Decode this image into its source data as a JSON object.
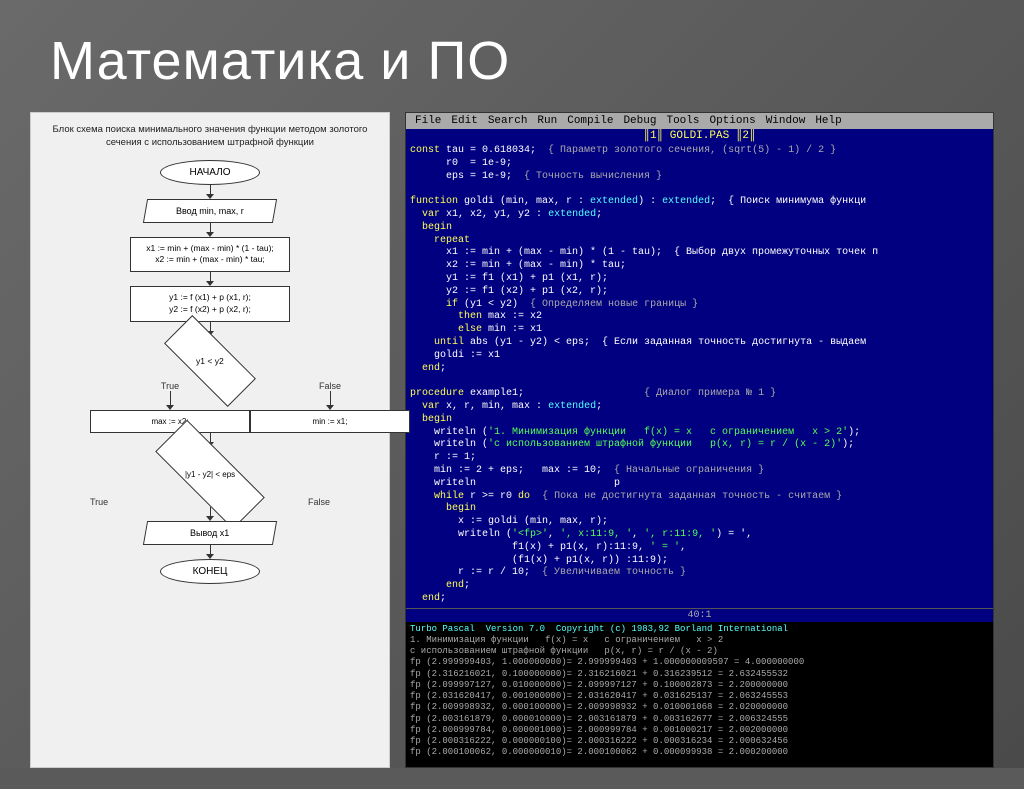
{
  "title": "Математика  и ПО",
  "flowchart": {
    "title": "Блок схема поиска минимального значения\nфункции методом золотого сечения\nс использованием штрафной функции",
    "nodes": {
      "start": "НАЧАЛО",
      "input": "Ввод min, max, r",
      "block1_line1": "x1 := min + (max - min) * (1 - tau);",
      "block1_line2": "x2 := min + (max - min) * tau;",
      "block2_line1": "y1 := f (x1) + p (x1, r);",
      "block2_line2": "y2 := f (x2) + p (x2, r);",
      "diamond1": "y1 < y2",
      "true_label1": "True",
      "false_label1": "False",
      "max_assign": "max := x2;",
      "min_assign": "min := x1;",
      "diamond2": "|y1 - y2| < eps",
      "true_label2": "True",
      "false_label2": "False",
      "output": "Вывод x1",
      "end": "КОНЕЦ"
    }
  },
  "code_editor": {
    "menubar": [
      "File",
      "Edit",
      "Search",
      "Run",
      "Compile",
      "Debug",
      "Tools",
      "Options",
      "Window",
      "Help"
    ],
    "titlebar": "GOLDI.PAS",
    "titlebar_right": "2",
    "lines": [
      "const tau = 0.618034;  { Параметр золотого сечения, (sqrt(5) - 1) / 2 }",
      "      r0  = 1e-9;",
      "      eps = 1e-9;  { Точность вычисления }",
      "",
      "function goldi (min, max, r : extended) : extended;  { Поиск минимума функци",
      "  var x1, x2, y1, y2 : extended;",
      "  begin",
      "    repeat",
      "      x1 := min + (max - min) * (1 - tau);  { Выбор двух промежуточных точек п",
      "      x2 := min + (max - min) * tau;",
      "      y1 := f1 (x1) + p1 (x1, r);",
      "      y2 := f1 (x2) + p1 (x2, r);",
      "      if (y1 < y2)  { Определяем новые границы }",
      "        then max := x2",
      "        else min := x1",
      "    until abs (y1 - y2) < eps;  { Если заданная точность достигнута - выдаем",
      "    goldi := x1",
      "  end;",
      "",
      "procedure example1;                    { Диалог примера № 1 }",
      "  var x, r, min, max : extended;",
      "  begin",
      "    writeln ('1. Минимизация функции   f(x) = x   с ограничением   x > 2');",
      "    writeln ('с использованием штрафной функции   p(x, r) = r / (x - 2)');",
      "    r := 1;",
      "    min := 2 + eps;   max := 10;  { Начальные ограничения }",
      "    writeln                       p",
      "    while r >= r0 do  { Пока не достигнута заданная точность - считаем }",
      "      begin",
      "        x := goldi (min, max, r);",
      "        writeln ('<fp>', ', x:11:9, ', ', r:11:9, ') = ',",
      "                 f1(x) + p1(x, r):11:9, ' = ',",
      "                 (f1(x) + p1(x, r)) :11:9);",
      "        r := r / 10;  { Увеличиваем точность }",
      "      end;",
      "  end;"
    ],
    "statusbar": "40:1",
    "output_header": "Turbo Pascal  Version 7.0  Copyright (c) 1983,92 Borland International",
    "output_lines": [
      "1. Минимизация функции   f(x) = x   с ограничением   x > 2",
      "с использованием штрафной функции   p(x, r) = r / (x - 2)",
      "fp (2.999999403, 1.000000000)= 2.999999403 + 1.000000009597 = 4.000000000",
      "fp (2.316216021, 0.100000000)= 2.316216021 + 0.316239512 = 2.632455532",
      "fp (2.099997127, 0.010000000)= 2.099997127 + 0.100002873 = 2.200000000",
      "fp (2.031620417, 0.001000000)= 2.031620417 + 0.031625137 = 2.063245553",
      "fp (2.009998932, 0.000100000)= 2.009998932 + 0.010001068 = 2.020000000",
      "fp (2.003161879, 0.000010000)= 2.003161879 + 0.003162677 = 2.006324555",
      "fp (2.000999784, 0.000001000)= 2.000999784 + 0.001000217 = 2.002000000",
      "fp (2.000316222, 0.000000100)= 2.000316222 + 0.000316234 = 2.000632456",
      "fp (2.000100062, 0.000000010)= 2.000100062 + 0.000099938 = 2.000200000"
    ]
  }
}
